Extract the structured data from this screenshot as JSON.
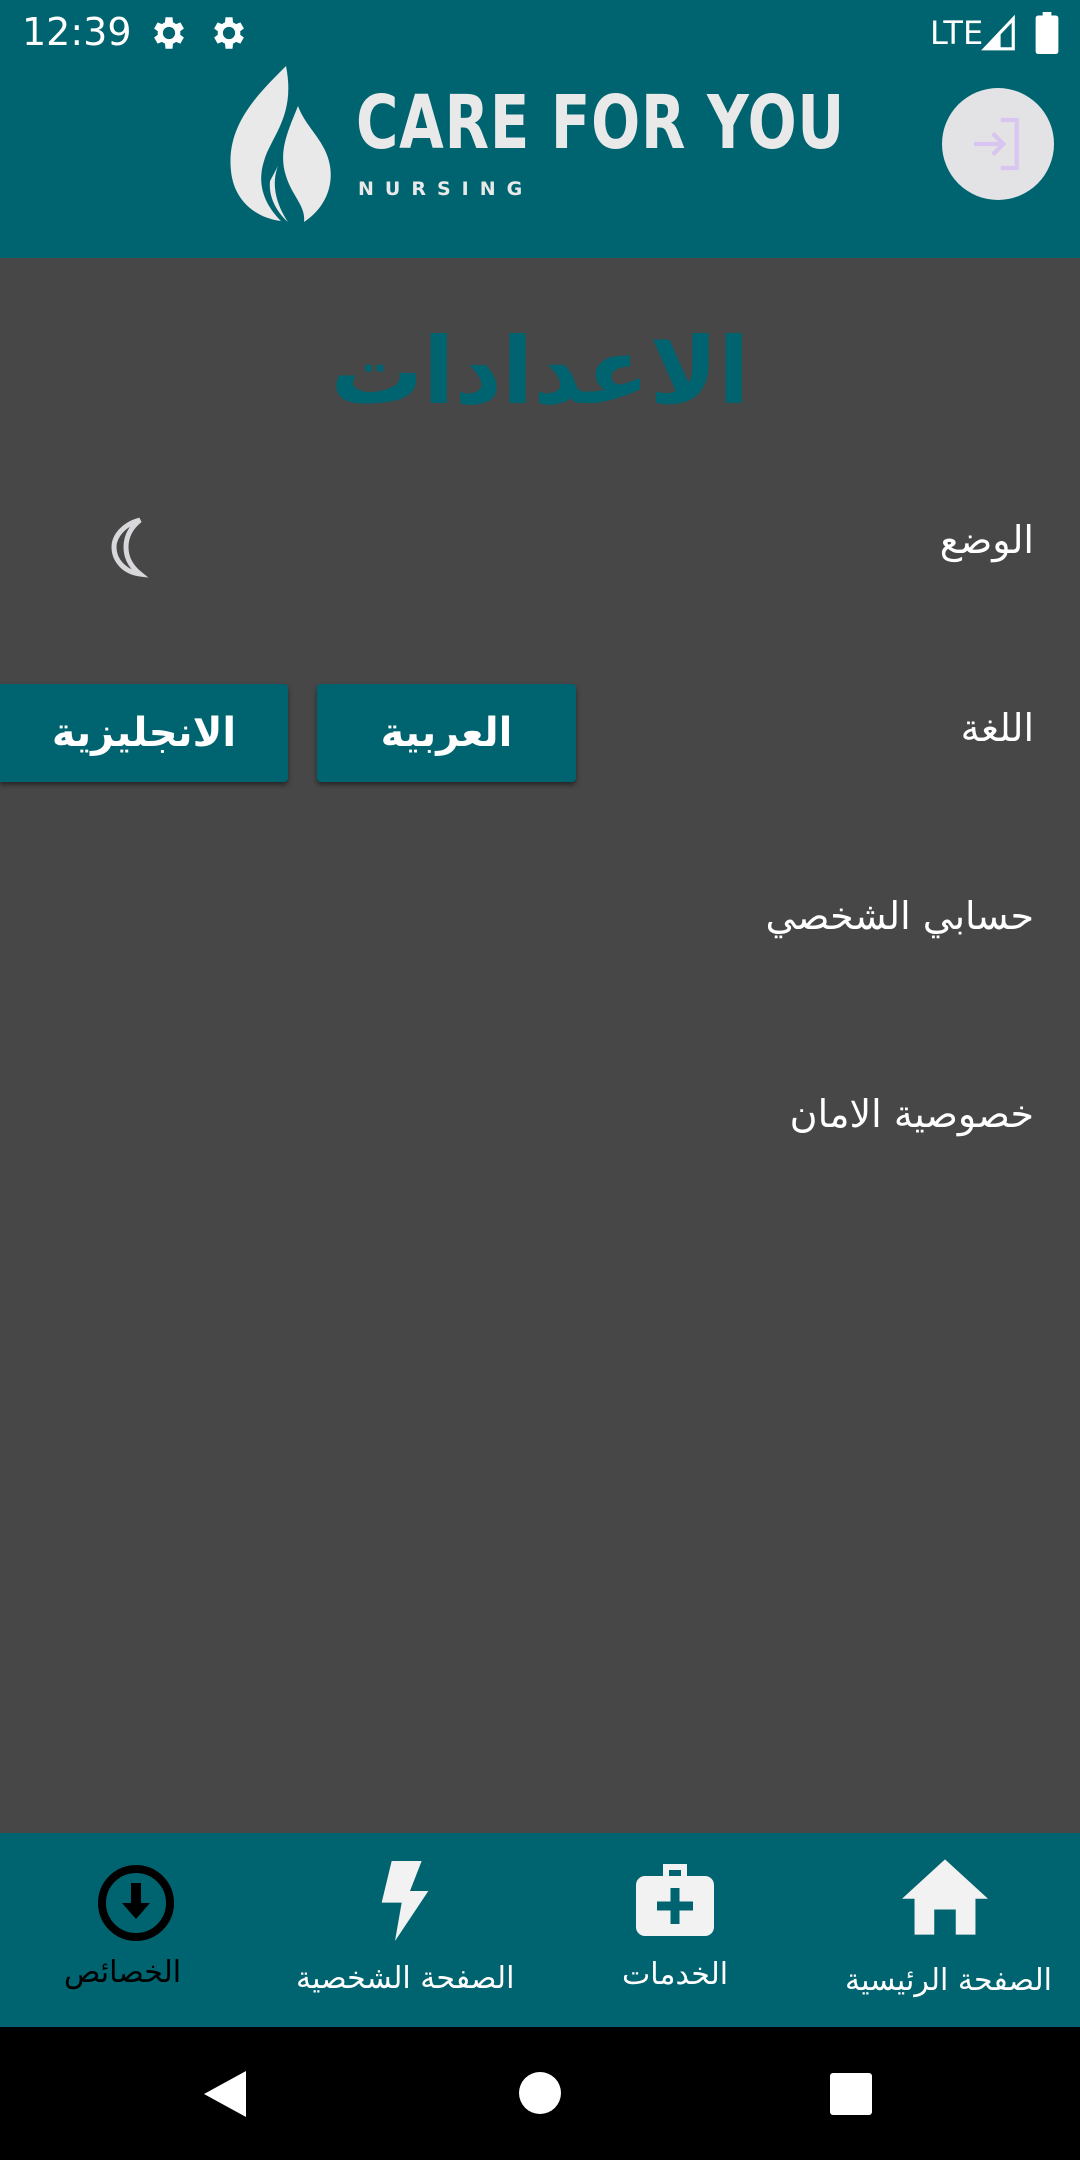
{
  "status_bar": {
    "time": "12:39",
    "network": "LTE",
    "icons": [
      "settings-icon",
      "settings-icon",
      "signal-icon",
      "battery-icon"
    ]
  },
  "header": {
    "logo_title": "CARE FOR YOU",
    "logo_subtitle": "NURSING",
    "logo_icon": "flame-logo-icon",
    "login_icon": "login-arrow-icon"
  },
  "settings": {
    "title": "الاعدادات",
    "mode_label": "الوضع",
    "mode_icon": "moon-icon",
    "language_label": "اللغة",
    "language_options": [
      "العربية",
      "الانجليزية"
    ],
    "account_label": "حسابي الشخصي",
    "privacy_label": "خصوصية الامان"
  },
  "bottom_nav": {
    "items": [
      {
        "label": "الصفحة الرئيسية",
        "icon": "home-icon"
      },
      {
        "label": "الخدمات",
        "icon": "medical-kit-icon"
      },
      {
        "label": "الصفحة الشخصية",
        "icon": "lightning-icon"
      },
      {
        "label": "الخصائص",
        "icon": "download-circle-icon",
        "active": true
      }
    ]
  },
  "colors": {
    "primary": "#006470",
    "background": "#474747",
    "text": "#ffffff",
    "active_nav": "#000000"
  }
}
